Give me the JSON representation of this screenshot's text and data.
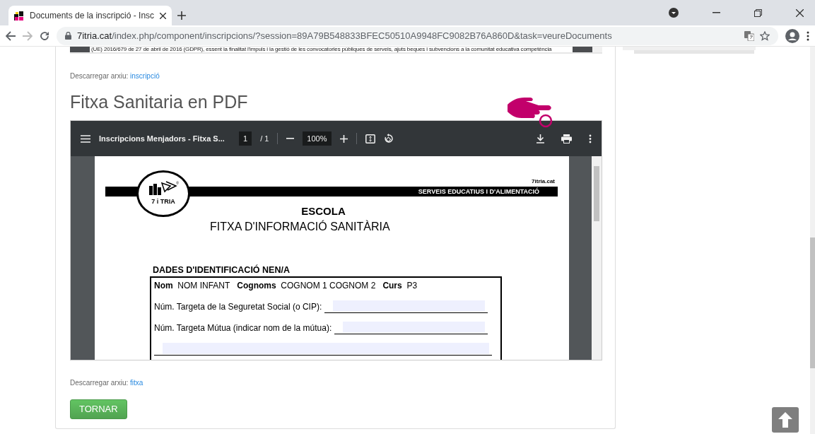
{
  "browser": {
    "tab": {
      "title": "Documents de la inscripció - Insc",
      "selected": true
    },
    "url": {
      "host": "7itria.cat",
      "path": "/index.php/component/inscripcions/?session=89A79B548833BFEC50510A9948FC9082B76A860D&task=veureDocuments"
    }
  },
  "page": {
    "top_strip_text": "(UE) 2016/679 de 27 de abril de 2016 (GDPR), essent la finalitat l'impuls i la gestió de les convocatories públiques de serveis, ajuts beques i subvencions a la comunitat educativa competència",
    "download_1": {
      "label": "Descarregar arxiu:",
      "link": "inscripció"
    },
    "heading": "Fitxa Sanitaria en PDF",
    "pdf_viewer": {
      "title": "Inscripcions Menjadors - Fitxa S...",
      "page_current": "1",
      "page_total": "/ 1",
      "zoom": "100%",
      "document": {
        "logo_text": "7 i TRIA",
        "logo_mark": "®",
        "site": "7itria.cat",
        "banner": "SERVEIS EDUCATIUS I D'ALIMENTACIÓ",
        "school": "ESCOLA",
        "form_title": "FITXA D'INFORMACIÓ SANITÀRIA",
        "section": "DADES D'IDENTIFICACIÓ NEN/A",
        "identity": [
          {
            "label": "Nom",
            "value": "NOM INFANT"
          },
          {
            "label": "Cognoms",
            "value": "COGNOM 1 COGNOM 2"
          },
          {
            "label": "Curs",
            "value": "P3"
          }
        ],
        "fields": [
          {
            "kind": "labeled",
            "label": "Núm. Targeta de la Seguretat Social (o CIP):"
          },
          {
            "kind": "labeled",
            "label": "Núm. Targeta Mútua (indicar nom de la mútua):"
          },
          {
            "kind": "line"
          }
        ]
      }
    },
    "download_2": {
      "label": "Descarregar arxiu:",
      "link": "fitxa"
    },
    "back_button": "TORNAR"
  }
}
